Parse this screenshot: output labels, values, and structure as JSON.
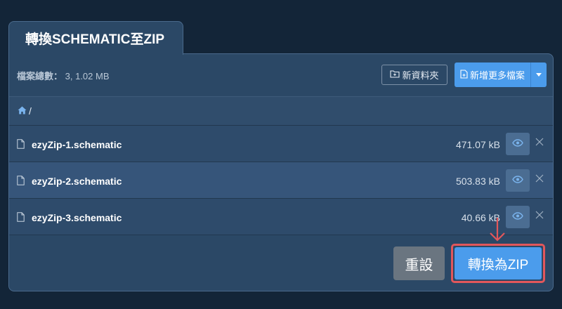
{
  "header": {
    "tab_title": "轉換SCHEMATIC至ZIP"
  },
  "toolbar": {
    "file_count_label": "檔案總數：",
    "file_count_value": "3, 1.02 MB",
    "new_folder_label": "新資料夾",
    "add_files_label": "新增更多檔案",
    "icons": {
      "new_folder": "folder-plus-icon",
      "add_files": "file-plus-icon",
      "dropdown": "caret-down-icon"
    }
  },
  "breadcrumb": {
    "path": "/",
    "icon": "home-icon"
  },
  "files": [
    {
      "name": "ezyZip-1.schematic",
      "size": "471.07 kB"
    },
    {
      "name": "ezyZip-2.schematic",
      "size": "503.83 kB"
    },
    {
      "name": "ezyZip-3.schematic",
      "size": "40.66 kB"
    }
  ],
  "actions": {
    "reset_label": "重設",
    "convert_label": "轉換為ZIP"
  },
  "colors": {
    "background": "#132538",
    "panel": "#2b4866",
    "accent_blue": "#4b9cec",
    "highlight_red": "#e2575b",
    "reset_gray": "#6a7580"
  }
}
